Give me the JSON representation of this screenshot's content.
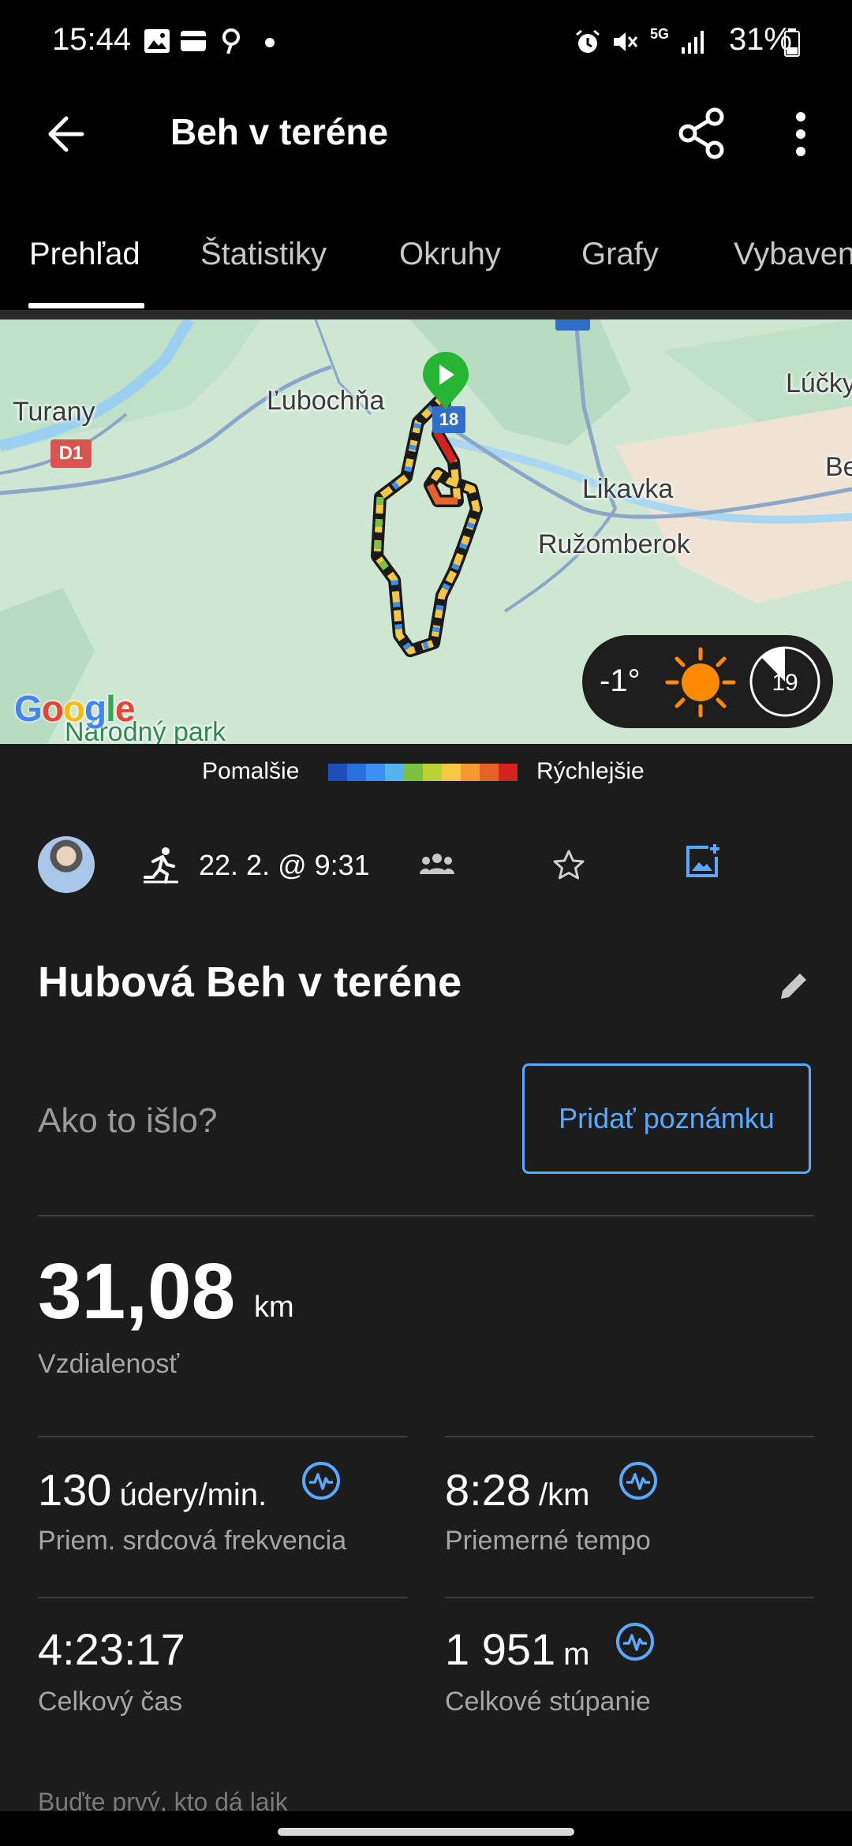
{
  "status_bar": {
    "time": "15:44",
    "battery": "31%",
    "network": "5G"
  },
  "app_bar": {
    "title": "Beh v teréne"
  },
  "tabs": [
    {
      "label": "Prehľad",
      "active": true
    },
    {
      "label": "Štatistiky",
      "active": false
    },
    {
      "label": "Okruhy",
      "active": false
    },
    {
      "label": "Grafy",
      "active": false
    },
    {
      "label": "Vybaven",
      "active": false
    }
  ],
  "map": {
    "labels": {
      "turany": "Turany",
      "lubochna": "Ľubochňa",
      "likavka": "Likavka",
      "ruzomberok": "Ružomberok",
      "lucky": "Lúčky",
      "be": "Be",
      "narodny_park": "Národný park",
      "road_d1": "D1",
      "road_18": "18"
    },
    "provider": "Google",
    "weather": {
      "temperature": "-1°",
      "icon": "sun-icon",
      "wind": "19"
    }
  },
  "legend": {
    "slower": "Pomalšie",
    "faster": "Rýchlejšie",
    "colors": [
      "#1d4fb8",
      "#2a6fdb",
      "#3b8ff0",
      "#57b3ee",
      "#7cc242",
      "#b9d334",
      "#f5c842",
      "#f29a2e",
      "#e8612a",
      "#d42222"
    ]
  },
  "activity": {
    "date": "22. 2. @ 9:31",
    "title": "Hubová Beh v teréne",
    "how_was_it": "Ako to išlo?",
    "add_note": "Pridať poznámku",
    "distance": {
      "value": "31,08",
      "unit": "km",
      "label": "Vzdialenosť"
    },
    "stats": [
      {
        "value": "130",
        "unit": "údery/min.",
        "label": "Priem. srdcová frekvencia",
        "has_icon": true
      },
      {
        "value": "8:28",
        "unit": "/km",
        "label": "Priemerné tempo",
        "has_icon": true
      },
      {
        "value": "4:23:17",
        "unit": "",
        "label": "Celkový čas",
        "has_icon": false
      },
      {
        "value": "1 951",
        "unit": "m",
        "label": "Celkové stúpanie",
        "has_icon": true
      }
    ],
    "teaser": "Buďte prvý, kto dá lajk"
  },
  "colors": {
    "accent": "#5aa9ff",
    "background": "#1c1c1c",
    "bar_background": "#000000",
    "weather_sun": "#ff8a00"
  }
}
